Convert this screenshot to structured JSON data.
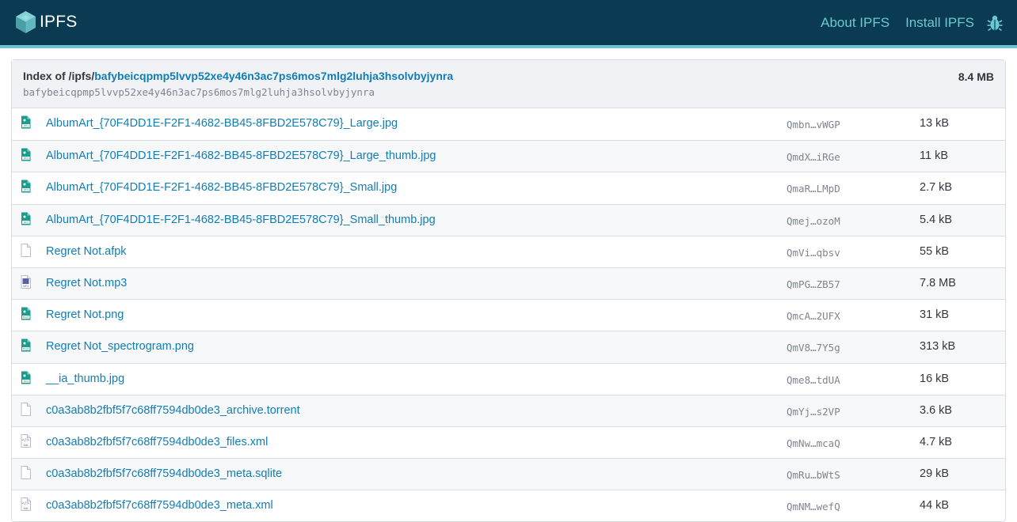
{
  "topbar": {
    "logo_text": "IPFS",
    "nav": [
      {
        "label": "About IPFS"
      },
      {
        "label": "Install IPFS"
      }
    ],
    "bug_icon": "bug-icon"
  },
  "colors": {
    "topbar": "#0b3a53",
    "accent": "#69c4cd",
    "link": "#117eb3",
    "image_icon": "#1a9d8c",
    "audio_icon": "#5b5fa8"
  },
  "listing": {
    "index_prefix": "Index of /ipfs/",
    "cid": "bafybeicqpmp5lvvp52xe4y46n3ac7ps6mos7mlg2luhja3hsolvbyjynra",
    "cid_sub": "bafybeicqpmp5lvvp52xe4y46n3ac7ps6mos7mlg2luhja3hsolvbyjynra",
    "total_size": "8.4 MB",
    "rows": [
      {
        "name": "AlbumArt_{70F4DD1E-F2F1-4682-BB45-8FBD2E578C79}_Large.jpg",
        "hash": "Qmbn…vWGP",
        "size": "13 kB",
        "icon": "jpg-file-icon"
      },
      {
        "name": "AlbumArt_{70F4DD1E-F2F1-4682-BB45-8FBD2E578C79}_Large_thumb.jpg",
        "hash": "QmdX…iRGe",
        "size": "11 kB",
        "icon": "jpg-file-icon"
      },
      {
        "name": "AlbumArt_{70F4DD1E-F2F1-4682-BB45-8FBD2E578C79}_Small.jpg",
        "hash": "QmaR…LMpD",
        "size": "2.7 kB",
        "icon": "jpg-file-icon"
      },
      {
        "name": "AlbumArt_{70F4DD1E-F2F1-4682-BB45-8FBD2E578C79}_Small_thumb.jpg",
        "hash": "Qmej…ozoM",
        "size": "5.4 kB",
        "icon": "jpg-file-icon"
      },
      {
        "name": "Regret Not.afpk",
        "hash": "QmVi…qbsv",
        "size": "55 kB",
        "icon": "generic-file-icon"
      },
      {
        "name": "Regret Not.mp3",
        "hash": "QmPG…ZB57",
        "size": "7.8 MB",
        "icon": "mp3-file-icon"
      },
      {
        "name": "Regret Not.png",
        "hash": "QmcA…2UFX",
        "size": "31 kB",
        "icon": "png-file-icon"
      },
      {
        "name": "Regret Not_spectrogram.png",
        "hash": "QmV8…7Y5g",
        "size": "313 kB",
        "icon": "png-file-icon"
      },
      {
        "name": "__ia_thumb.jpg",
        "hash": "Qme8…tdUA",
        "size": "16 kB",
        "icon": "jpg-file-icon"
      },
      {
        "name": "c0a3ab8b2fbf5f7c68ff7594db0de3_archive.torrent",
        "hash": "QmYj…s2VP",
        "size": "3.6 kB",
        "icon": "generic-file-icon"
      },
      {
        "name": "c0a3ab8b2fbf5f7c68ff7594db0de3_files.xml",
        "hash": "QmNw…mcaQ",
        "size": "4.7 kB",
        "icon": "xml-file-icon"
      },
      {
        "name": "c0a3ab8b2fbf5f7c68ff7594db0de3_meta.sqlite",
        "hash": "QmRu…bWtS",
        "size": "29 kB",
        "icon": "generic-file-icon"
      },
      {
        "name": "c0a3ab8b2fbf5f7c68ff7594db0de3_meta.xml",
        "hash": "QmNM…wefQ",
        "size": "44 kB",
        "icon": "xml-file-icon"
      }
    ]
  }
}
